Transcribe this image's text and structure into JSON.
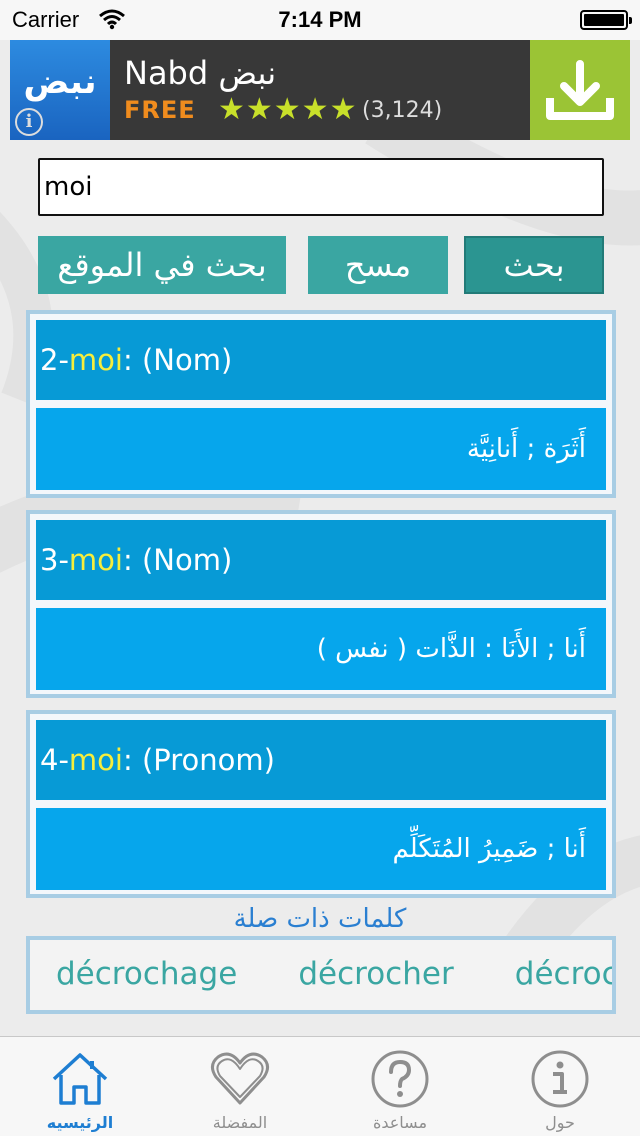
{
  "status_bar": {
    "carrier": "Carrier",
    "time": "7:14 PM"
  },
  "ad": {
    "icon_text": "نبض",
    "title": "Nabd نبض",
    "price": "FREE",
    "rating": 4.5,
    "stars": "★★★★★",
    "review_count": "(3,124)"
  },
  "search": {
    "value": "moi"
  },
  "buttons": {
    "search_site": "بحث في الموقع",
    "clear": "مسح",
    "search": "بحث"
  },
  "results": [
    {
      "prefix": "2- ",
      "term": "moi",
      "pos": " : (Nom)",
      "translation": "أَثَرَة ; أَنانِيَّة"
    },
    {
      "prefix": "3- ",
      "term": "moi",
      "pos": " : (Nom)",
      "translation": "أَنا ; الأَنَا : الذَّات ( نفس )"
    },
    {
      "prefix": "4- ",
      "term": "moi",
      "pos": " : (Pronom)",
      "translation": "أَنا ; ضَمِيرُ المُتَكَلِّم"
    }
  ],
  "related": {
    "title": "كلمات ذات صلة",
    "words": [
      "décrochage",
      "décrocher",
      "décrocheur"
    ]
  },
  "tabs": [
    {
      "label": "الرئيسيه",
      "icon": "home-icon",
      "active": true
    },
    {
      "label": "المفضلة",
      "icon": "heart-icon",
      "active": false
    },
    {
      "label": "مساعدة",
      "icon": "help-icon",
      "active": false
    },
    {
      "label": "حول",
      "icon": "info-icon",
      "active": false
    }
  ],
  "colors": {
    "accent_teal": "#3aa6a2",
    "card_header": "#079ad6",
    "card_body": "#06a6ec",
    "highlight": "#f6ee3c",
    "tab_active": "#1e7ed2"
  }
}
